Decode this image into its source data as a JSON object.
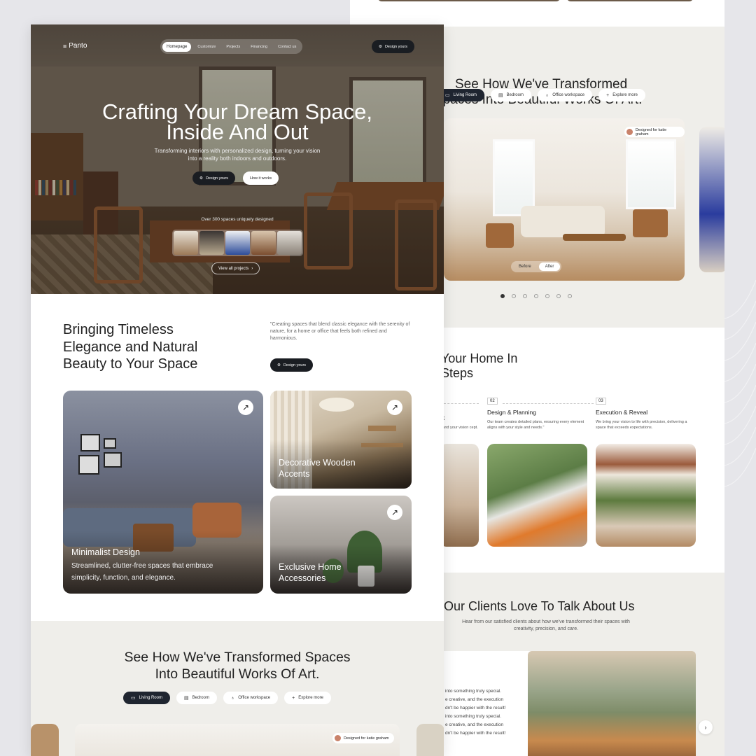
{
  "brand": "Panto",
  "nav": {
    "items": [
      "Homepage",
      "Customize",
      "Projects",
      "Financing",
      "Contact us"
    ],
    "active": 0,
    "cta": "Design yours"
  },
  "hero": {
    "title": "Crafting Your Dream Space, Inside And Out",
    "subtitle": "Transforming interiors with personalized design, turning your vision into a reality both indoors and outdoors.",
    "primary_button": "Design yours",
    "secondary_button": "How it works",
    "spaces_count": "Over 300 spaces uniquely designed",
    "view_all": "View all projects"
  },
  "intro": {
    "heading": "Bringing Timeless Elegance and Natural Beauty to Your Space",
    "quote": "\"Creating spaces that blend classic elegance with the serenity of nature, for a home or office that feels both refined and harmonious.",
    "button": "Design yours"
  },
  "cards": [
    {
      "title": "Minimalist Design",
      "description": "Streamlined, clutter-free spaces that embrace simplicity, function, and elegance."
    },
    {
      "title": "Decorative Wooden Accents",
      "description": ""
    },
    {
      "title": "Exclusive Home Accessories",
      "description": ""
    }
  ],
  "transform": {
    "title": "See How We've Transformed Spaces Into Beautiful Works Of Art.",
    "title_line1": "See How We've Transformed",
    "title_line2": "Spaces Into Beautiful Works Of Art.",
    "tabs": [
      "Living Room",
      "Bedroom",
      "Office workspace",
      "Explore more"
    ],
    "active_tab": 0,
    "designed_for": "Designed for katie graham",
    "before": "Before",
    "after": "After",
    "slide_count": 7,
    "active_slide": 0
  },
  "steps": {
    "title_fragment_line1": "Your Home In",
    "title_fragment_line2": "Steps",
    "items": [
      {
        "number": "",
        "title": "pt",
        "description": "stand your vision cept."
      },
      {
        "number": "02",
        "title": "Design & Planning",
        "description": "Our team creates detailed plans, ensuring every element aligns with your style and needs.\""
      },
      {
        "number": "03",
        "title": "Execution & Reveal",
        "description": "We bring your vision to life with precision, delivering a space that exceeds expectations."
      }
    ]
  },
  "clients": {
    "title": "Our Clients Love To Talk About Us",
    "subtitle": "Hear from our satisfied clients about how we've transformed their spaces with creativity, precision, and care.",
    "testimonial_lines": [
      "into something truly special.",
      "e creative, and the execution",
      "dn't be happier with the result!",
      "into something truly special.",
      "e creative, and the execution",
      "dn't be happier with the result!"
    ]
  },
  "icons": {
    "logo": "panto-logo-icon",
    "design": "gear-icon",
    "arrow": "arrow-up-right-icon",
    "next": "chevron-right-icon",
    "bedroom": "bed-icon",
    "office": "lamp-icon",
    "explore": "plus-icon",
    "living": "sofa-icon"
  },
  "colors": {
    "dark_button": "#1a1d22",
    "section_bg": "#efeeea",
    "page_bg": "#e6e6ea"
  }
}
